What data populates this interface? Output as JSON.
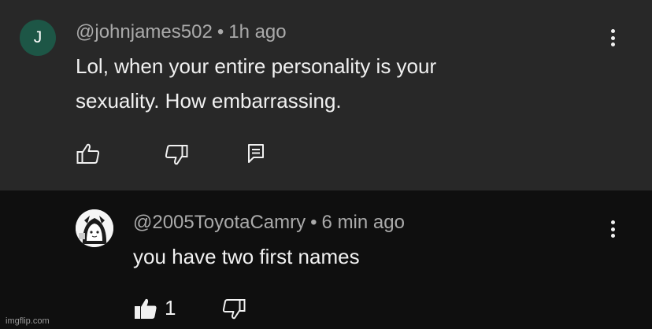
{
  "comment": {
    "avatar_letter": "J",
    "username": "@johnjames502",
    "timestamp": "1h ago",
    "text_line1": "Lol, when your entire personality is your",
    "text_line2": "sexuality. How embarrassing.",
    "avatar_color": "#1d5646",
    "icons": [
      "like-icon",
      "dislike-icon",
      "reply-icon",
      "more-icon"
    ]
  },
  "reply": {
    "username": "@2005ToyotaCamry",
    "timestamp": "6 min ago",
    "text": "you have two first names",
    "like_count": "1",
    "icons": [
      "like-filled-icon",
      "dislike-icon",
      "more-icon"
    ]
  },
  "separator": "•",
  "watermark": "imgflip.com",
  "colors": {
    "comment_bg": "#282828",
    "reply_bg": "#0f0f0f",
    "text": "#f1f1f1",
    "meta": "#aaaaaa"
  }
}
